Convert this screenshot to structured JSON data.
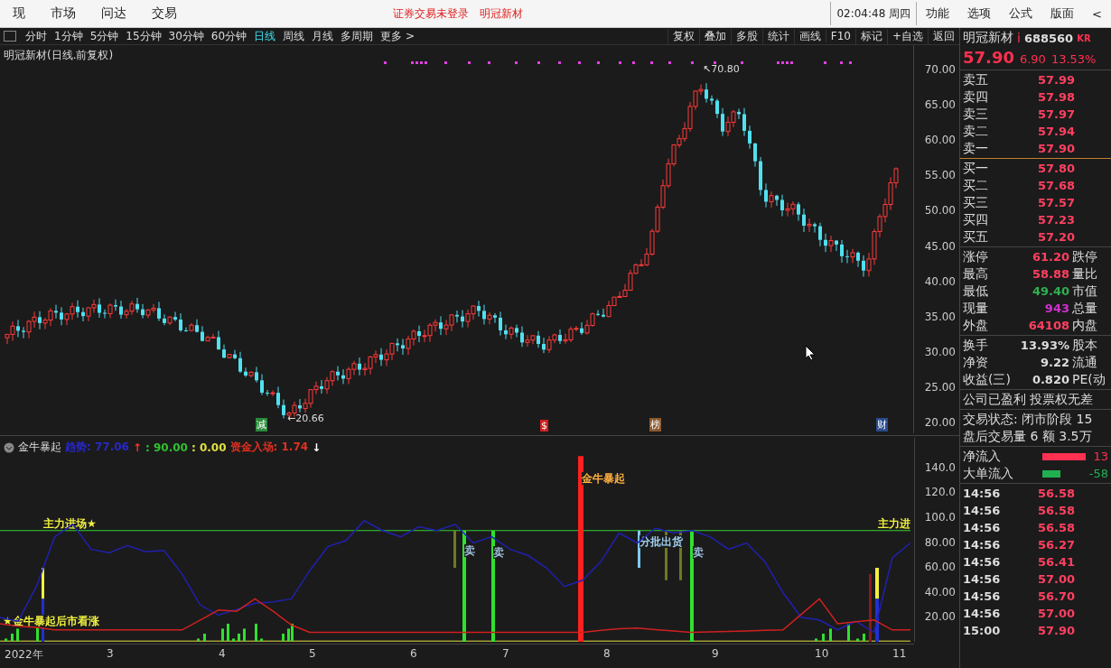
{
  "menu": {
    "items": [
      "现",
      "市场",
      "问达",
      "交易"
    ],
    "login_status": "证券交易未登录",
    "stock_name": "明冠新材",
    "clock": "02:04:48 周四",
    "right_items": [
      "功能",
      "选项",
      "公式",
      "版面"
    ],
    "collapse": "<"
  },
  "toolbar": {
    "periods": [
      {
        "label": "分时",
        "selected": false
      },
      {
        "label": "1分钟",
        "selected": false
      },
      {
        "label": "5分钟",
        "selected": false
      },
      {
        "label": "15分钟",
        "selected": false
      },
      {
        "label": "30分钟",
        "selected": false
      },
      {
        "label": "60分钟",
        "selected": false
      },
      {
        "label": "日线",
        "selected": true
      },
      {
        "label": "周线",
        "selected": false
      },
      {
        "label": "月线",
        "selected": false
      },
      {
        "label": "多周期",
        "selected": false
      }
    ],
    "more": "更多 >",
    "actions": [
      "复权",
      "叠加",
      "多股",
      "统计",
      "画线",
      "F10",
      "标记",
      "+自选",
      "返回"
    ]
  },
  "chart": {
    "title": "明冠新材(日线.前复权)",
    "price_axis": [
      "70.00",
      "65.00",
      "60.00",
      "55.00",
      "50.00",
      "45.00",
      "40.00",
      "35.00",
      "30.00",
      "25.00",
      "20.00"
    ],
    "high_label": "↖70.80",
    "low_label": "←20.66",
    "events": [
      {
        "label": "减",
        "color": "#2a8a3a"
      },
      {
        "label": "$",
        "color": "#d02020"
      },
      {
        "label": "榜",
        "color": "#8a5a30"
      },
      {
        "label": "财",
        "color": "#2a4a8a"
      }
    ]
  },
  "indicator": {
    "name": "金牛暴起",
    "readouts": [
      {
        "text": "趋势: 77.06",
        "color": "#2828c8"
      },
      {
        "text": "↑",
        "color": "#ff3030"
      },
      {
        "text": ": 90.00",
        "color": "#30c030"
      },
      {
        "text": ": 0.00",
        "color": "#e0e040"
      },
      {
        "text": "资金入场: 1.74",
        "color": "#e03020"
      },
      {
        "text": "↓",
        "color": "#ffffff"
      }
    ],
    "chart_data": {
      "type": "line",
      "ylim": [
        0.4,
        164.7
      ],
      "yticks": [
        {
          "value": 140,
          "label": "140.0"
        },
        {
          "value": 120,
          "label": "120.0"
        },
        {
          "value": 100,
          "label": "100.0"
        },
        {
          "value": 80,
          "label": "80.00"
        },
        {
          "value": 60,
          "label": "60.00"
        },
        {
          "value": 40,
          "label": "40.00"
        },
        {
          "value": 20,
          "label": "20.00"
        }
      ],
      "series": [
        {
          "color": "#2020b0",
          "values": [
            20,
            17,
            45,
            85,
            95,
            75,
            72,
            78,
            73,
            74,
            55,
            30,
            22,
            26.5,
            31.5,
            32.5,
            35,
            57.5,
            77,
            82,
            98,
            90,
            85,
            93,
            90,
            95,
            80,
            85,
            75,
            70,
            60,
            45,
            50,
            65,
            88,
            80,
            92,
            88,
            90,
            85,
            75,
            80,
            65,
            40,
            20,
            18,
            10,
            17,
            8,
            68,
            80
          ]
        },
        {
          "color": "#d02020",
          "values": [
            15,
            13,
            12,
            10,
            10,
            10,
            10,
            10,
            10,
            10,
            10,
            18,
            26,
            25,
            35,
            25,
            14,
            8,
            8,
            8,
            8,
            8,
            8,
            8,
            8,
            8,
            8,
            8,
            8,
            8,
            8,
            8,
            8,
            9.6,
            11,
            11.4,
            10.3,
            9.1,
            8,
            8.4,
            8.8,
            9.2,
            9.6,
            10,
            22.5,
            35,
            15,
            16.5,
            18,
            10,
            10
          ]
        }
      ]
    },
    "labels": [
      {
        "text": "主力进场★",
        "color": "#f0f040"
      },
      {
        "text": "★金牛暴起后市看涨",
        "color": "#f0f040"
      },
      {
        "text": "卖",
        "color": "#a0c0e0"
      },
      {
        "text": "卖",
        "color": "#a0c0e0"
      },
      {
        "text": "金牛暴起",
        "color": "#ffb040"
      },
      {
        "text": "分批出货",
        "color": "#a0d0f0"
      },
      {
        "text": "卖",
        "color": "#a0c0e0"
      },
      {
        "text": "主力进",
        "color": "#f0f040"
      }
    ]
  },
  "x_axis": [
    "2022年",
    "3",
    "4",
    "5",
    "6",
    "7",
    "8",
    "9",
    "10",
    "11"
  ],
  "quote": {
    "name": "明冠新材",
    "flag": "i",
    "code": "688560",
    "badge": "KR",
    "price": "57.90",
    "change": "6.90",
    "percent": "13.53%",
    "sells": [
      {
        "label": "卖五",
        "price": "57.99"
      },
      {
        "label": "卖四",
        "price": "57.98"
      },
      {
        "label": "卖三",
        "price": "57.97"
      },
      {
        "label": "卖二",
        "price": "57.94"
      },
      {
        "label": "卖一",
        "price": "57.90"
      }
    ],
    "buys": [
      {
        "label": "买一",
        "price": "57.80"
      },
      {
        "label": "买二",
        "price": "57.68"
      },
      {
        "label": "买三",
        "price": "57.57"
      },
      {
        "label": "买四",
        "price": "57.23"
      },
      {
        "label": "买五",
        "price": "57.20"
      }
    ],
    "stats": [
      {
        "label": "涨停",
        "value": "61.20",
        "label2": "跌停",
        "color": "#ff4060"
      },
      {
        "label": "最高",
        "value": "58.88",
        "label2": "量比",
        "color": "#ff4060"
      },
      {
        "label": "最低",
        "value": "49.40",
        "label2": "市值",
        "color": "#30b050"
      },
      {
        "label": "现量",
        "value": "943",
        "label2": "总量",
        "color": "#d030d0"
      },
      {
        "label": "外盘",
        "value": "64108",
        "label2": "内盘",
        "color": "#ff4060"
      }
    ],
    "fundamentals": [
      {
        "label": "换手",
        "value": "13.93%",
        "label2": "股本"
      },
      {
        "label": "净资",
        "value": "9.22",
        "label2": "流通"
      },
      {
        "label": "收益(三)",
        "value": "0.820",
        "label2": "PE(动"
      }
    ],
    "notes": [
      "公司已盈利 投票权无差",
      "交易状态: 闭市阶段 15",
      "盘后交易量 6 额 3.5万"
    ],
    "flows": [
      {
        "label": "净流入",
        "value": "13",
        "color": "#ff3050"
      },
      {
        "label": "大单流入",
        "value": "-58",
        "color": "#20b050"
      }
    ],
    "ticks": [
      {
        "time": "14:56",
        "price": "56.58"
      },
      {
        "time": "14:56",
        "price": "56.58"
      },
      {
        "time": "14:56",
        "price": "56.58"
      },
      {
        "time": "14:56",
        "price": "56.27"
      },
      {
        "time": "14:56",
        "price": "56.41"
      },
      {
        "time": "14:56",
        "price": "57.00"
      },
      {
        "time": "14:56",
        "price": "56.70"
      },
      {
        "time": "14:56",
        "price": "57.00"
      },
      {
        "time": "15:00",
        "price": "57.90"
      }
    ]
  }
}
